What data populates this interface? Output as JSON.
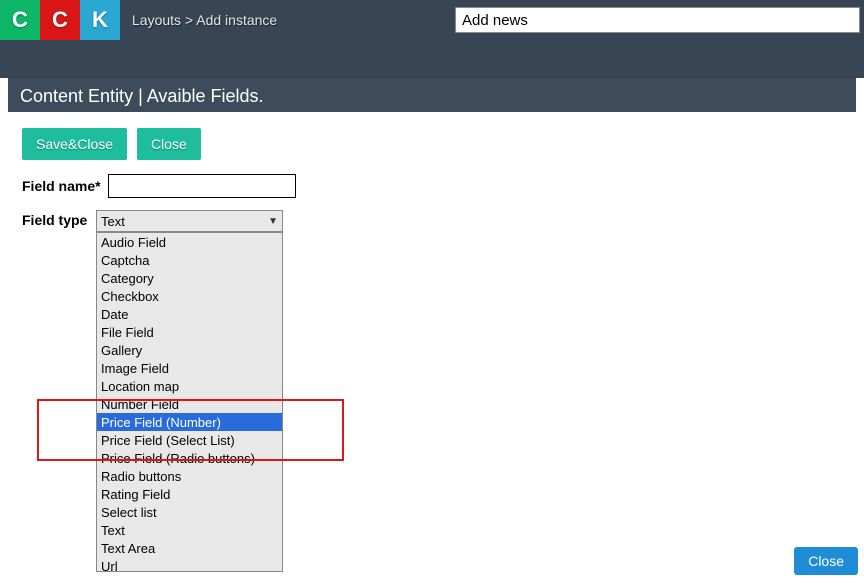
{
  "logo": {
    "c1": "C",
    "c2": "C",
    "k": "K"
  },
  "breadcrumb": {
    "part1": "Layouts",
    "sep": ">",
    "part2": "Add instance"
  },
  "search": {
    "value": "Add news"
  },
  "panel": {
    "title": "Content Entity | Avaible Fields."
  },
  "buttons": {
    "save_close": "Save&Close",
    "close": "Close"
  },
  "form": {
    "field_name_label": "Field name*",
    "field_name_value": "",
    "field_type_label": "Field type",
    "field_type_selected": "Text"
  },
  "dropdown": {
    "options": [
      "Audio Field",
      "Captcha",
      "Category",
      "Checkbox",
      "Date",
      "File Field",
      "Gallery",
      "Image Field",
      "Location map",
      "Number Field",
      "Price Field (Number)",
      "Price Field (Select List)",
      "Price Field (Radio buttons)",
      "Radio buttons",
      "Rating Field",
      "Select list",
      "Text",
      "Text Area",
      "Url"
    ],
    "selected_index": 10
  },
  "footer": {
    "close": "Close"
  }
}
